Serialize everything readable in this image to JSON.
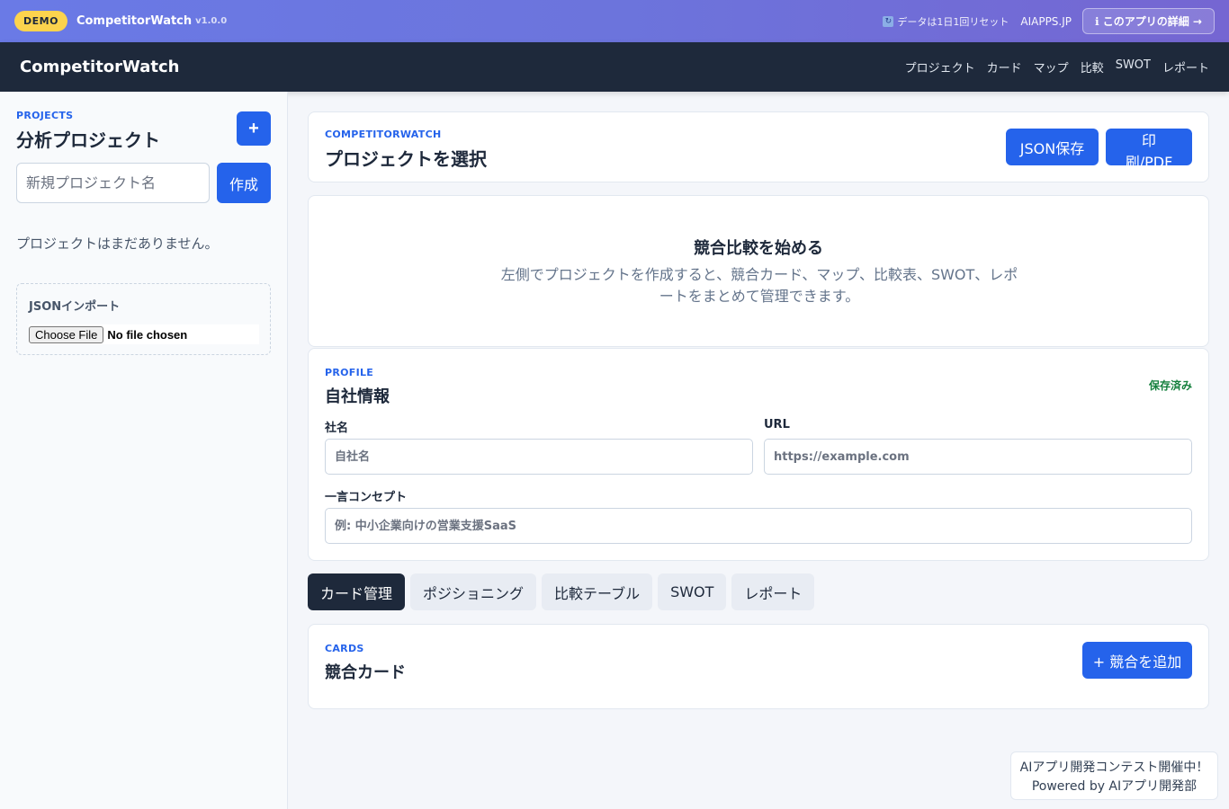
{
  "demo_bar": {
    "badge": "DEMO",
    "app_name": "CompetitorWatch",
    "version": "v1.0.0",
    "reset_icon": "refresh-icon",
    "reset_text": "データは1日1回リセット",
    "site": "AIAPPS.JP",
    "info_button": "ℹ このアプリの詳細 →"
  },
  "nav": {
    "brand": "CompetitorWatch",
    "links": [
      "プロジェクト",
      "カード",
      "マップ",
      "比較",
      "SWOT",
      "レポート"
    ]
  },
  "sidebar": {
    "eyebrow": "PROJECTS",
    "title": "分析プロジェクト",
    "add_button": "+",
    "new_project_placeholder": "新規プロジェクト名",
    "create_button": "作成",
    "empty_text": "プロジェクトはまだありません。",
    "import_title": "JSONインポート",
    "file_button": "Choose File",
    "file_status": "No file chosen"
  },
  "header": {
    "eyebrow": "COMPETITORWATCH",
    "title": "プロジェクトを選択",
    "json_button": "JSON保存",
    "print_button": "印刷/PDF"
  },
  "start": {
    "title": "競合比較を始める",
    "description": "左側でプロジェクトを作成すると、競合カード、マップ、比較表、SWOT、レポートをまとめて管理できます。"
  },
  "profile": {
    "eyebrow": "PROFILE",
    "title": "自社情報",
    "status": "保存済み",
    "company_label": "社名",
    "company_placeholder": "自社名",
    "url_label": "URL",
    "url_placeholder": "https://example.com",
    "concept_label": "一言コンセプト",
    "concept_placeholder": "例: 中小企業向けの営業支援SaaS"
  },
  "tabs": [
    {
      "label": "カード管理",
      "active": true
    },
    {
      "label": "ポジショニング",
      "active": false
    },
    {
      "label": "比較テーブル",
      "active": false
    },
    {
      "label": "SWOT",
      "active": false
    },
    {
      "label": "レポート",
      "active": false
    }
  ],
  "cards": {
    "eyebrow": "CARDS",
    "title": "競合カード",
    "add_button": "+ 競合を追加"
  },
  "contest": {
    "line1": "AIアプリ開発コンテスト開催中！",
    "line2": "Powered by AIアプリ開発部"
  },
  "colors": {
    "accent": "#2563eb",
    "nav_bg": "#1e293b",
    "badge": "#fcd34d",
    "saved": "#15803d"
  }
}
